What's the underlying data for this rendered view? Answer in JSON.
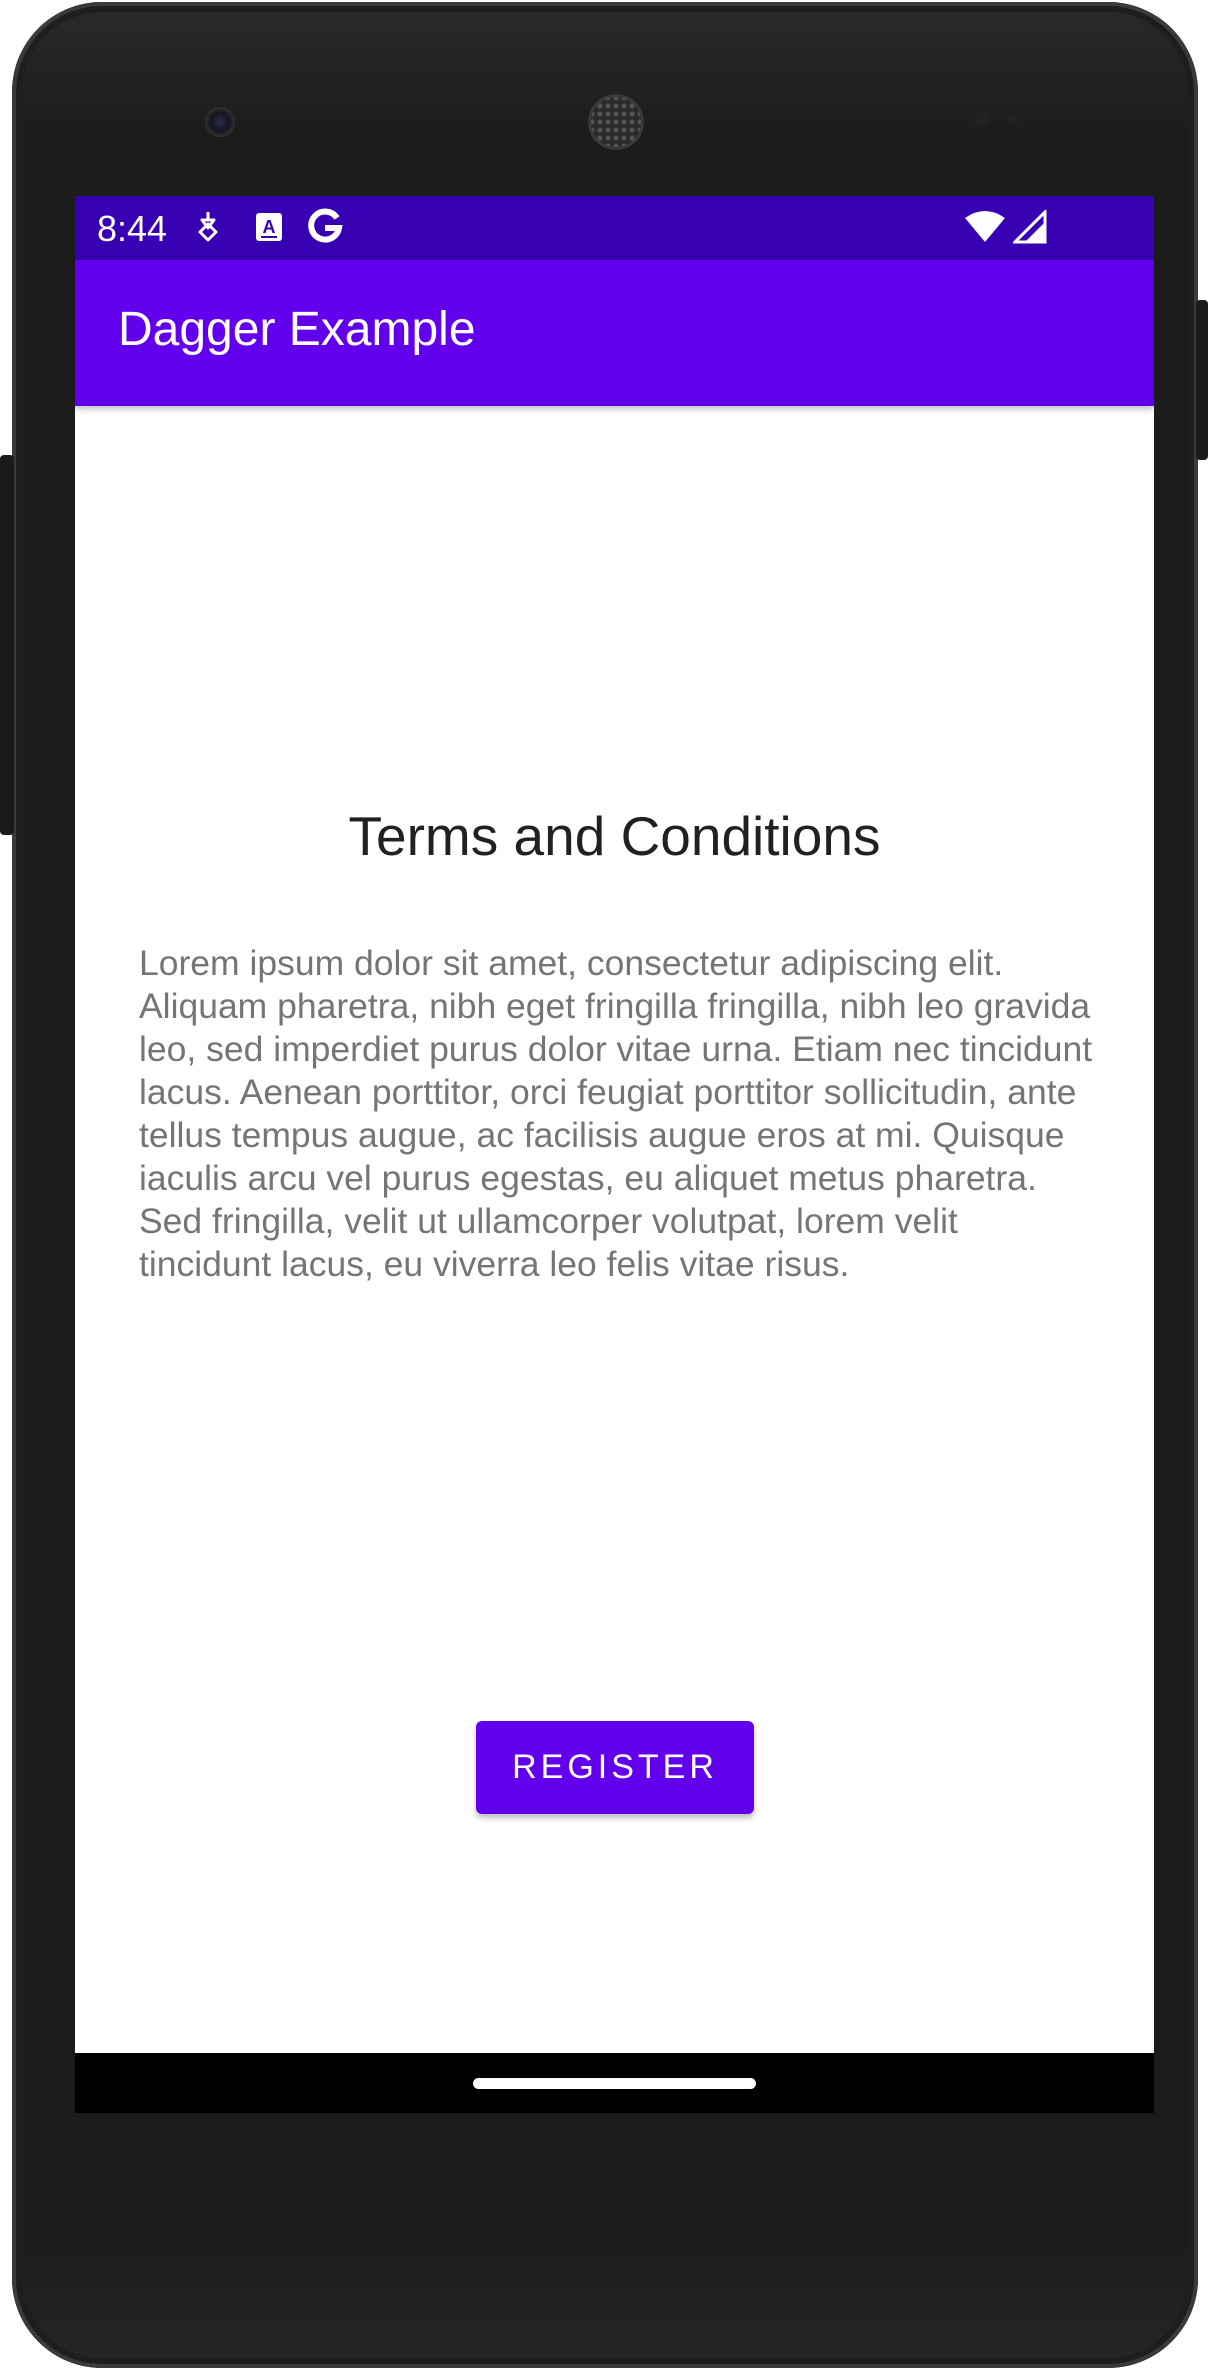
{
  "status_bar": {
    "time": "8:44",
    "background_color": "#3700b3",
    "left_icons": [
      "location-pin-icon",
      "text-a-icon",
      "google-g-icon"
    ],
    "right_icons": [
      "wifi-icon",
      "cellular-signal-icon"
    ]
  },
  "app_bar": {
    "title": "Dagger Example",
    "background_color": "#6200ee"
  },
  "content": {
    "heading": "Terms and Conditions",
    "body": "Lorem ipsum dolor sit amet, consectetur adipiscing elit. Aliquam pharetra, nibh eget fringilla fringilla, nibh leo gravida leo, sed imperdiet purus dolor vitae urna. Etiam nec tincidunt lacus. Aenean porttitor, orci feugiat porttitor sollicitudin, ante tellus tempus augue, ac facilisis augue eros at mi. Quisque iaculis arcu vel purus egestas, eu aliquet metus pharetra. Sed fringilla, velit ut ullamcorper volutpat, lorem velit tincidunt lacus, eu viverra leo felis vitae risus."
  },
  "actions": {
    "register_label": "REGISTER",
    "register_color": "#6200ee"
  },
  "nav_bar": {
    "handle": "home-handle"
  }
}
